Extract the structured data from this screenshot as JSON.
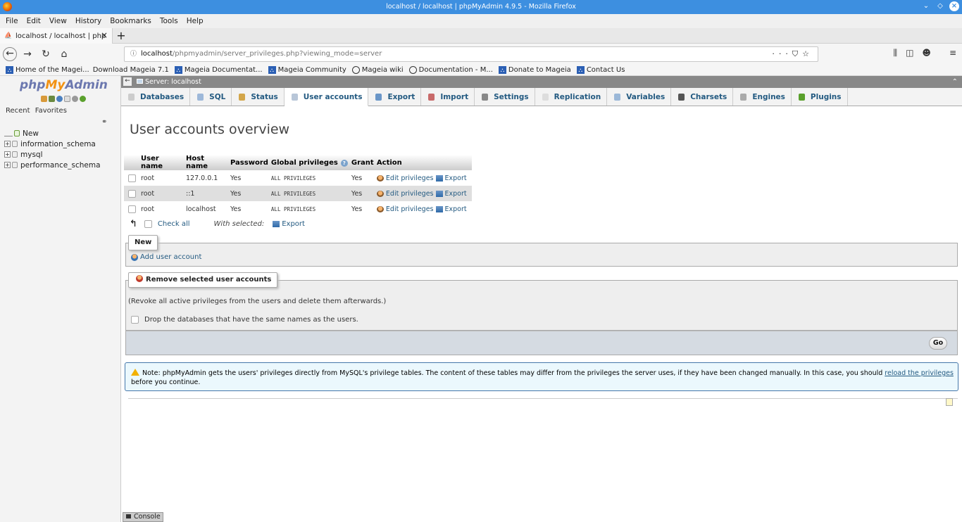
{
  "window": {
    "title": "localhost / localhost | phpMyAdmin 4.9.5 - Mozilla Firefox"
  },
  "menu": [
    "File",
    "Edit",
    "View",
    "History",
    "Bookmarks",
    "Tools",
    "Help"
  ],
  "tab": {
    "label": "localhost / localhost | php"
  },
  "url": {
    "host": "localhost",
    "path": "/phpmyadmin/server_privileges.php?viewing_mode=server"
  },
  "bookmarks": [
    "Home of the Magei...",
    "Download Mageia 7.1",
    "Mageia Documentat...",
    "Mageia Community",
    "Mageia wiki",
    "Documentation - M...",
    "Donate to Mageia",
    "Contact Us"
  ],
  "pma_nav": {
    "logo_php": "php",
    "logo_my": "My",
    "logo_admin": "Admin",
    "recent": "Recent",
    "favorites": "Favorites",
    "new": "New",
    "databases": [
      "information_schema",
      "mysql",
      "performance_schema"
    ]
  },
  "serverbar": {
    "label": "Server: localhost"
  },
  "tabs": [
    "Databases",
    "SQL",
    "Status",
    "User accounts",
    "Export",
    "Import",
    "Settings",
    "Replication",
    "Variables",
    "Charsets",
    "Engines",
    "Plugins"
  ],
  "page": {
    "title": "User accounts overview",
    "columns": [
      "User name",
      "Host name",
      "Password",
      "Global privileges",
      "Grant",
      "Action"
    ],
    "rows": [
      {
        "user": "root",
        "host": "127.0.0.1",
        "password": "Yes",
        "privileges": "ALL PRIVILEGES",
        "grant": "Yes",
        "edit": "Edit privileges",
        "export": "Export"
      },
      {
        "user": "root",
        "host": "::1",
        "password": "Yes",
        "privileges": "ALL PRIVILEGES",
        "grant": "Yes",
        "edit": "Edit privileges",
        "export": "Export"
      },
      {
        "user": "root",
        "host": "localhost",
        "password": "Yes",
        "privileges": "ALL PRIVILEGES",
        "grant": "Yes",
        "edit": "Edit privileges",
        "export": "Export"
      }
    ],
    "check_all": "Check all",
    "with_selected": "With selected:",
    "with_selected_export": "Export",
    "new_legend": "New",
    "add_user": "Add user account",
    "remove_legend": "Remove selected user accounts",
    "revoke_text": "(Revoke all active privileges from the users and delete them afterwards.)",
    "drop_db_label": "Drop the databases that have the same names as the users.",
    "go": "Go",
    "notice_pre": "Note: phpMyAdmin gets the users' privileges directly from MySQL's privilege tables. The content of these tables may differ from the privileges the server uses, if they have been changed manually. In this case, you should ",
    "notice_link": "reload the privileges",
    "notice_post": "before you continue."
  },
  "console": {
    "label": "Console"
  },
  "colors": {
    "titlebar": "#3d8fe0",
    "link": "#235a81",
    "logo_php": "#6c78af",
    "logo_my": "#f29111"
  }
}
